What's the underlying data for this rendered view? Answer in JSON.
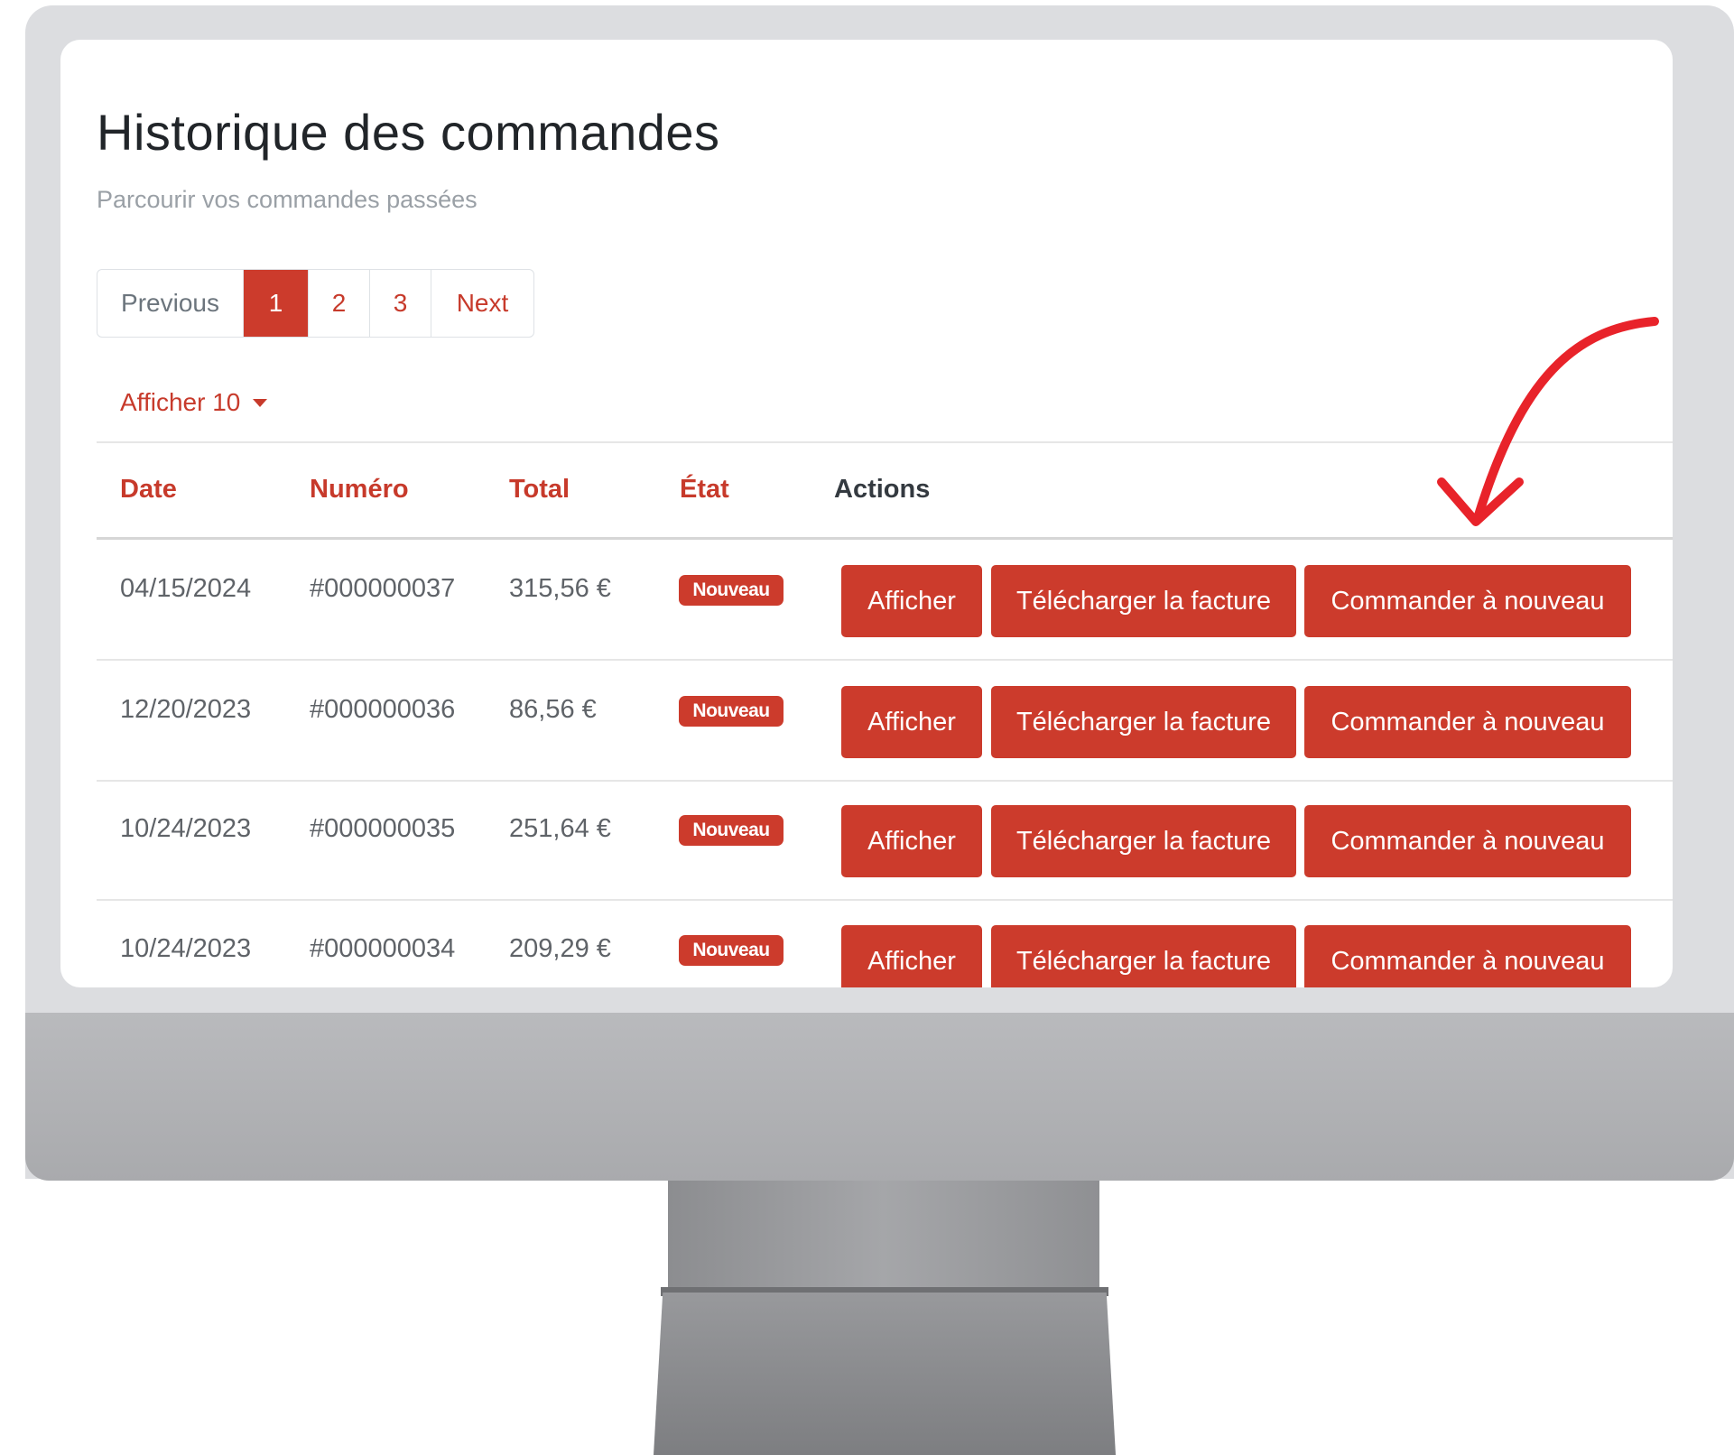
{
  "page": {
    "title": "Historique des commandes",
    "subtitle": "Parcourir vos commandes passées"
  },
  "pagination": {
    "previous": "Previous",
    "pages": [
      "1",
      "2",
      "3"
    ],
    "active_page": "1",
    "next": "Next"
  },
  "page_size": {
    "label": "Afficher 10"
  },
  "table": {
    "headers": {
      "date": "Date",
      "number": "Numéro",
      "total": "Total",
      "status": "État",
      "actions": "Actions"
    },
    "rows": [
      {
        "date": "04/15/2024",
        "number": "#000000037",
        "total": "315,56 €",
        "status": "Nouveau"
      },
      {
        "date": "12/20/2023",
        "number": "#000000036",
        "total": "86,56 €",
        "status": "Nouveau"
      },
      {
        "date": "10/24/2023",
        "number": "#000000035",
        "total": "251,64 €",
        "status": "Nouveau"
      },
      {
        "date": "10/24/2023",
        "number": "#000000034",
        "total": "209,29 €",
        "status": "Nouveau"
      }
    ],
    "actions": {
      "view": "Afficher",
      "invoice": "Télécharger la facture",
      "reorder": "Commander à nouveau"
    }
  },
  "colors": {
    "accent": "#cc3b2c",
    "annotation_arrow": "#e8232a"
  },
  "icons": {
    "dropdown": "caret-down-icon",
    "annotation": "curved-arrow-icon"
  }
}
